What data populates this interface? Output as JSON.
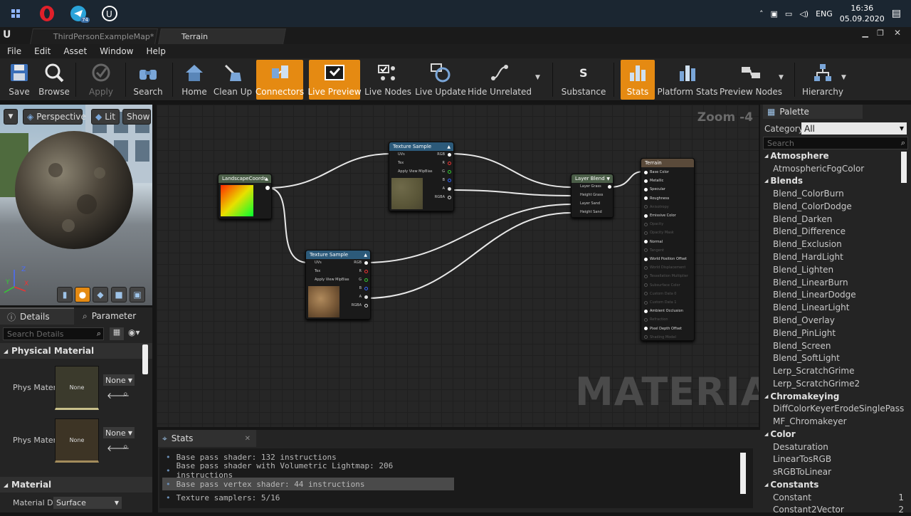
{
  "taskbar": {
    "apps": [
      "start-icon",
      "opera-icon",
      "telegram-icon",
      "unreal-icon"
    ],
    "telegram_badge": "74",
    "lang": "ENG",
    "time": "16:36",
    "date": "05.09.2020"
  },
  "tabs": [
    {
      "label": "ThirdPersonExampleMap*"
    },
    {
      "label": "Terrain"
    }
  ],
  "menu": [
    "File",
    "Edit",
    "Asset",
    "Window",
    "Help"
  ],
  "toolbar": [
    {
      "label": "Save",
      "icon": "save-icon"
    },
    {
      "label": "Browse",
      "icon": "browse-icon"
    },
    {
      "label": "Apply",
      "icon": "apply-icon",
      "disabled": true
    },
    {
      "label": "Search",
      "icon": "search-icon"
    },
    {
      "label": "Home",
      "icon": "home-icon"
    },
    {
      "label": "Clean Up",
      "icon": "clean-up-icon"
    },
    {
      "label": "Connectors",
      "icon": "connectors-icon",
      "active": true
    },
    {
      "label": "Live Preview",
      "icon": "live-preview-icon",
      "active": true
    },
    {
      "label": "Live Nodes",
      "icon": "live-nodes-icon"
    },
    {
      "label": "Live Update",
      "icon": "live-update-icon"
    },
    {
      "label": "Hide Unrelated",
      "icon": "hide-unrelated-icon"
    },
    {
      "label": "Substance",
      "icon": "substance-icon"
    },
    {
      "label": "Stats",
      "icon": "stats-icon",
      "active": true
    },
    {
      "label": "Platform Stats",
      "icon": "platform-stats-icon"
    },
    {
      "label": "Preview Nodes",
      "icon": "preview-nodes-icon"
    },
    {
      "label": "Hierarchy",
      "icon": "hierarchy-icon"
    }
  ],
  "viewport": {
    "perspective": "Perspective",
    "lit": "Lit",
    "show": "Show"
  },
  "details": {
    "tab_details": "Details",
    "tab_parameter": "Parameter",
    "search_placeholder": "Search Details",
    "section_physical": "Physical Material",
    "phys1_label": "Phys Mater",
    "phys1_thumb": "None",
    "phys1_value": "None",
    "phys2_label": "Phys Mater",
    "phys2_thumb": "None",
    "phys2_value": "None",
    "section_material": "Material",
    "material_domain_label": "Material Dc",
    "material_domain_value": "Surface"
  },
  "graph": {
    "zoom": "Zoom -4",
    "watermark": "MATERIAL",
    "nodes": {
      "landscape": {
        "title": "LandscapeCoords"
      },
      "tex1": {
        "title": "Texture Sample",
        "pins_in": [
          "UVs",
          "Tex",
          "Apply View MipBias"
        ],
        "pins_out": [
          "RGB",
          "R",
          "G",
          "B",
          "A",
          "RGBA"
        ]
      },
      "tex2": {
        "title": "Texture Sample",
        "pins_in": [
          "UVs",
          "Tex",
          "Apply View MipBias"
        ],
        "pins_out": [
          "RGB",
          "R",
          "G",
          "B",
          "A",
          "RGBA"
        ]
      },
      "blend": {
        "title": "Layer Blend",
        "pins": [
          "Layer Grass",
          "Height Grass",
          "Layer Sand",
          "Height Sand"
        ]
      },
      "terrain": {
        "title": "Terrain",
        "pins": [
          "Base Color",
          "Metallic",
          "Specular",
          "Roughness",
          "Anisotropy",
          "Emissive Color",
          "Opacity",
          "Opacity Mask",
          "Normal",
          "Tangent",
          "World Position Offset",
          "World Displacement",
          "Tessellation Multiplier",
          "Subsurface Color",
          "Custom Data 0",
          "Custom Data 1",
          "Ambient Occlusion",
          "Refraction",
          "Pixel Depth Offset",
          "Shading Model"
        ]
      }
    }
  },
  "stats": {
    "tab": "Stats",
    "lines": [
      "Base pass shader: 132 instructions",
      "Base pass shader with Volumetric Lightmap: 206 instructions",
      "Base pass vertex shader: 44 instructions",
      "Texture samplers: 5/16"
    ]
  },
  "palette": {
    "tab": "Palette",
    "category_label": "Category:",
    "category_value": "All",
    "search_placeholder": "Search",
    "groups": [
      {
        "name": "Atmosphere",
        "items": [
          {
            "name": "AtmosphericFogColor"
          }
        ]
      },
      {
        "name": "Blends",
        "items": [
          {
            "name": "Blend_ColorBurn"
          },
          {
            "name": "Blend_ColorDodge"
          },
          {
            "name": "Blend_Darken"
          },
          {
            "name": "Blend_Difference"
          },
          {
            "name": "Blend_Exclusion"
          },
          {
            "name": "Blend_HardLight"
          },
          {
            "name": "Blend_Lighten"
          },
          {
            "name": "Blend_LinearBurn"
          },
          {
            "name": "Blend_LinearDodge"
          },
          {
            "name": "Blend_LinearLight"
          },
          {
            "name": "Blend_Overlay"
          },
          {
            "name": "Blend_PinLight"
          },
          {
            "name": "Blend_Screen"
          },
          {
            "name": "Blend_SoftLight"
          },
          {
            "name": "Lerp_ScratchGrime"
          },
          {
            "name": "Lerp_ScratchGrime2"
          }
        ]
      },
      {
        "name": "Chromakeying",
        "items": [
          {
            "name": "DiffColorKeyerErodeSinglePass"
          },
          {
            "name": "MF_Chromakeyer"
          }
        ]
      },
      {
        "name": "Color",
        "items": [
          {
            "name": "Desaturation"
          },
          {
            "name": "LinearTosRGB"
          },
          {
            "name": "sRGBToLinear"
          }
        ]
      },
      {
        "name": "Constants",
        "items": [
          {
            "name": "Constant",
            "hotkey": "1"
          },
          {
            "name": "Constant2Vector",
            "hotkey": "2"
          }
        ]
      }
    ]
  },
  "colors": {
    "accent": "#e58a12",
    "texture_header": "#2c5a7a",
    "function_header": "#4b5e48",
    "result_header": "#5a4a3a"
  }
}
